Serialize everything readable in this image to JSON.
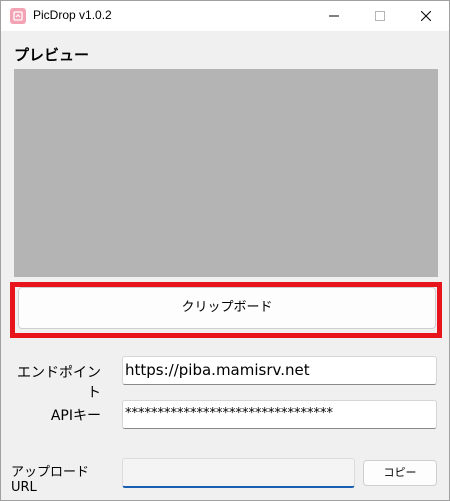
{
  "window": {
    "title": "PicDrop v1.0.2"
  },
  "preview": {
    "label": "プレビュー",
    "background_color": "#b4b4b4"
  },
  "clipboard_button": {
    "label": "クリップボード",
    "highlight_color": "#e8141c"
  },
  "endpoint": {
    "label": "エンドポイント",
    "value": "https://piba.mamisrv.net"
  },
  "api_key": {
    "label": "APIキー",
    "value": "********************************"
  },
  "upload_url": {
    "label": "アップロードURL",
    "value": "",
    "copy_label": "コピー"
  },
  "icons": {
    "app": "app-logo-icon",
    "minimize": "minimize-icon",
    "maximize": "maximize-icon",
    "close": "close-icon"
  }
}
